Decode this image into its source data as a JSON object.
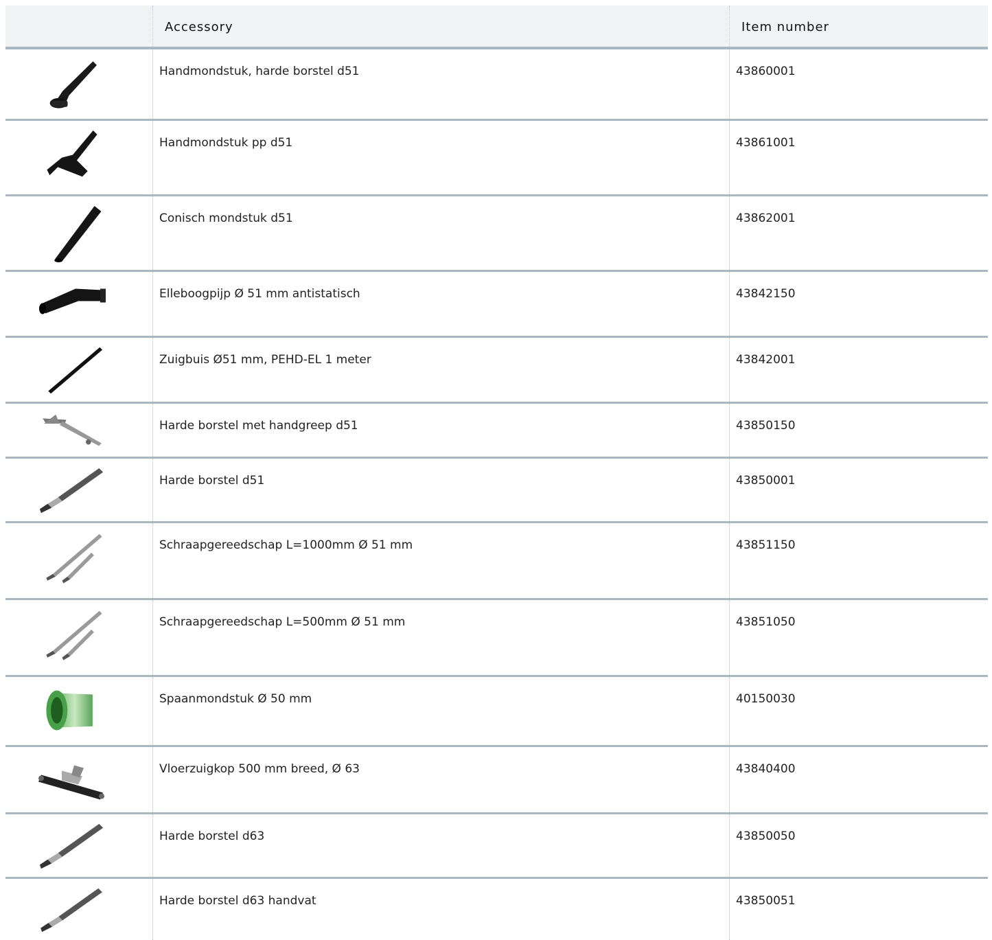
{
  "table": {
    "headers": {
      "image": "",
      "accessory": "Accessory",
      "item_number": "Item number"
    },
    "rows": [
      {
        "icon": "hand-nozzle-brush-icon",
        "name": "Handmondstuk, harde borstel d51",
        "number": "43860001"
      },
      {
        "icon": "hand-nozzle-pp-icon",
        "name": "Handmondstuk pp d51",
        "number": "43861001"
      },
      {
        "icon": "conical-nozzle-icon",
        "name": "Conisch mondstuk d51",
        "number": "43862001"
      },
      {
        "icon": "elbow-pipe-icon",
        "name": "Elleboogpijp Ø 51 mm antistatisch",
        "number": "43842150"
      },
      {
        "icon": "suction-tube-icon",
        "name": "Zuigbuis Ø51 mm, PEHD-EL 1 meter",
        "number": "43842001"
      },
      {
        "icon": "brush-with-handle-icon",
        "name": "Harde borstel met handgreep d51",
        "number": "43850150"
      },
      {
        "icon": "hard-brush-icon",
        "name": "Harde borstel d51",
        "number": "43850001"
      },
      {
        "icon": "scraper-tool-icon",
        "name": "Schraapgereedschap L=1000mm Ø 51 mm",
        "number": "43851150"
      },
      {
        "icon": "scraper-tool-icon",
        "name": "Schraapgereedschap L=500mm Ø 51 mm",
        "number": "43851050"
      },
      {
        "icon": "chip-nozzle-icon",
        "name": "Spaanmondstuk Ø 50 mm",
        "number": "40150030"
      },
      {
        "icon": "floor-head-icon",
        "name": "Vloerzuigkop 500 mm breed, Ø 63",
        "number": "43840400"
      },
      {
        "icon": "hard-brush-icon",
        "name": "Harde borstel d63",
        "number": "43850050"
      },
      {
        "icon": "hard-brush-icon",
        "name": "Harde borstel d63 handvat",
        "number": "43850051"
      }
    ]
  },
  "colors": {
    "header_bg": "#f2f3f4",
    "rule": "#a9b7c1",
    "dotted_divider": "#b8c2ca"
  }
}
